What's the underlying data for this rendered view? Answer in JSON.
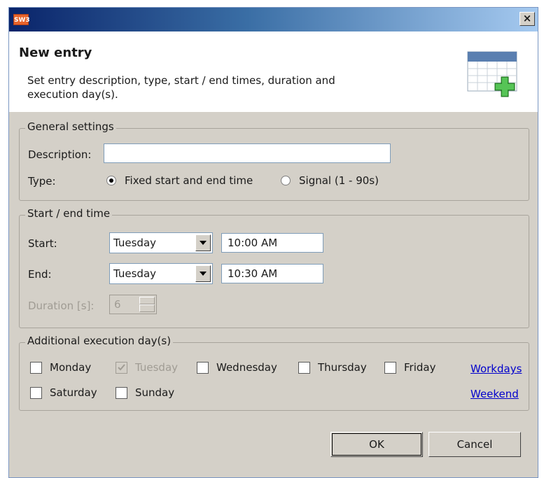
{
  "window": {
    "app_icon_text": "SW3",
    "close_glyph": "×"
  },
  "header": {
    "title": "New entry",
    "description": "Set entry description, type, start / end times, duration and execution day(s).",
    "icon": "calendar-add-icon"
  },
  "general": {
    "legend": "General settings",
    "description_label": "Description:",
    "description_value": "",
    "type_label": "Type:",
    "type_options": [
      {
        "label": "Fixed start and end time",
        "selected": true
      },
      {
        "label": "Signal (1 - 90s)",
        "selected": false
      }
    ]
  },
  "times": {
    "legend": "Start / end time",
    "start_label": "Start:",
    "start_day": "Tuesday",
    "start_time": "10:00 AM",
    "end_label": "End:",
    "end_day": "Tuesday",
    "end_time": "10:30 AM",
    "duration_label": "Duration [s]:",
    "duration_value": "6"
  },
  "days": {
    "legend": "Additional execution day(s)",
    "items": [
      {
        "label": "Monday",
        "checked": false,
        "disabled": false
      },
      {
        "label": "Tuesday",
        "checked": true,
        "disabled": true
      },
      {
        "label": "Wednesday",
        "checked": false,
        "disabled": false
      },
      {
        "label": "Thursday",
        "checked": false,
        "disabled": false
      },
      {
        "label": "Friday",
        "checked": false,
        "disabled": false
      },
      {
        "label": "Saturday",
        "checked": false,
        "disabled": false
      },
      {
        "label": "Sunday",
        "checked": false,
        "disabled": false
      }
    ],
    "workdays_link": "Workdays",
    "weekend_link": "Weekend"
  },
  "buttons": {
    "ok": "OK",
    "cancel": "Cancel"
  }
}
